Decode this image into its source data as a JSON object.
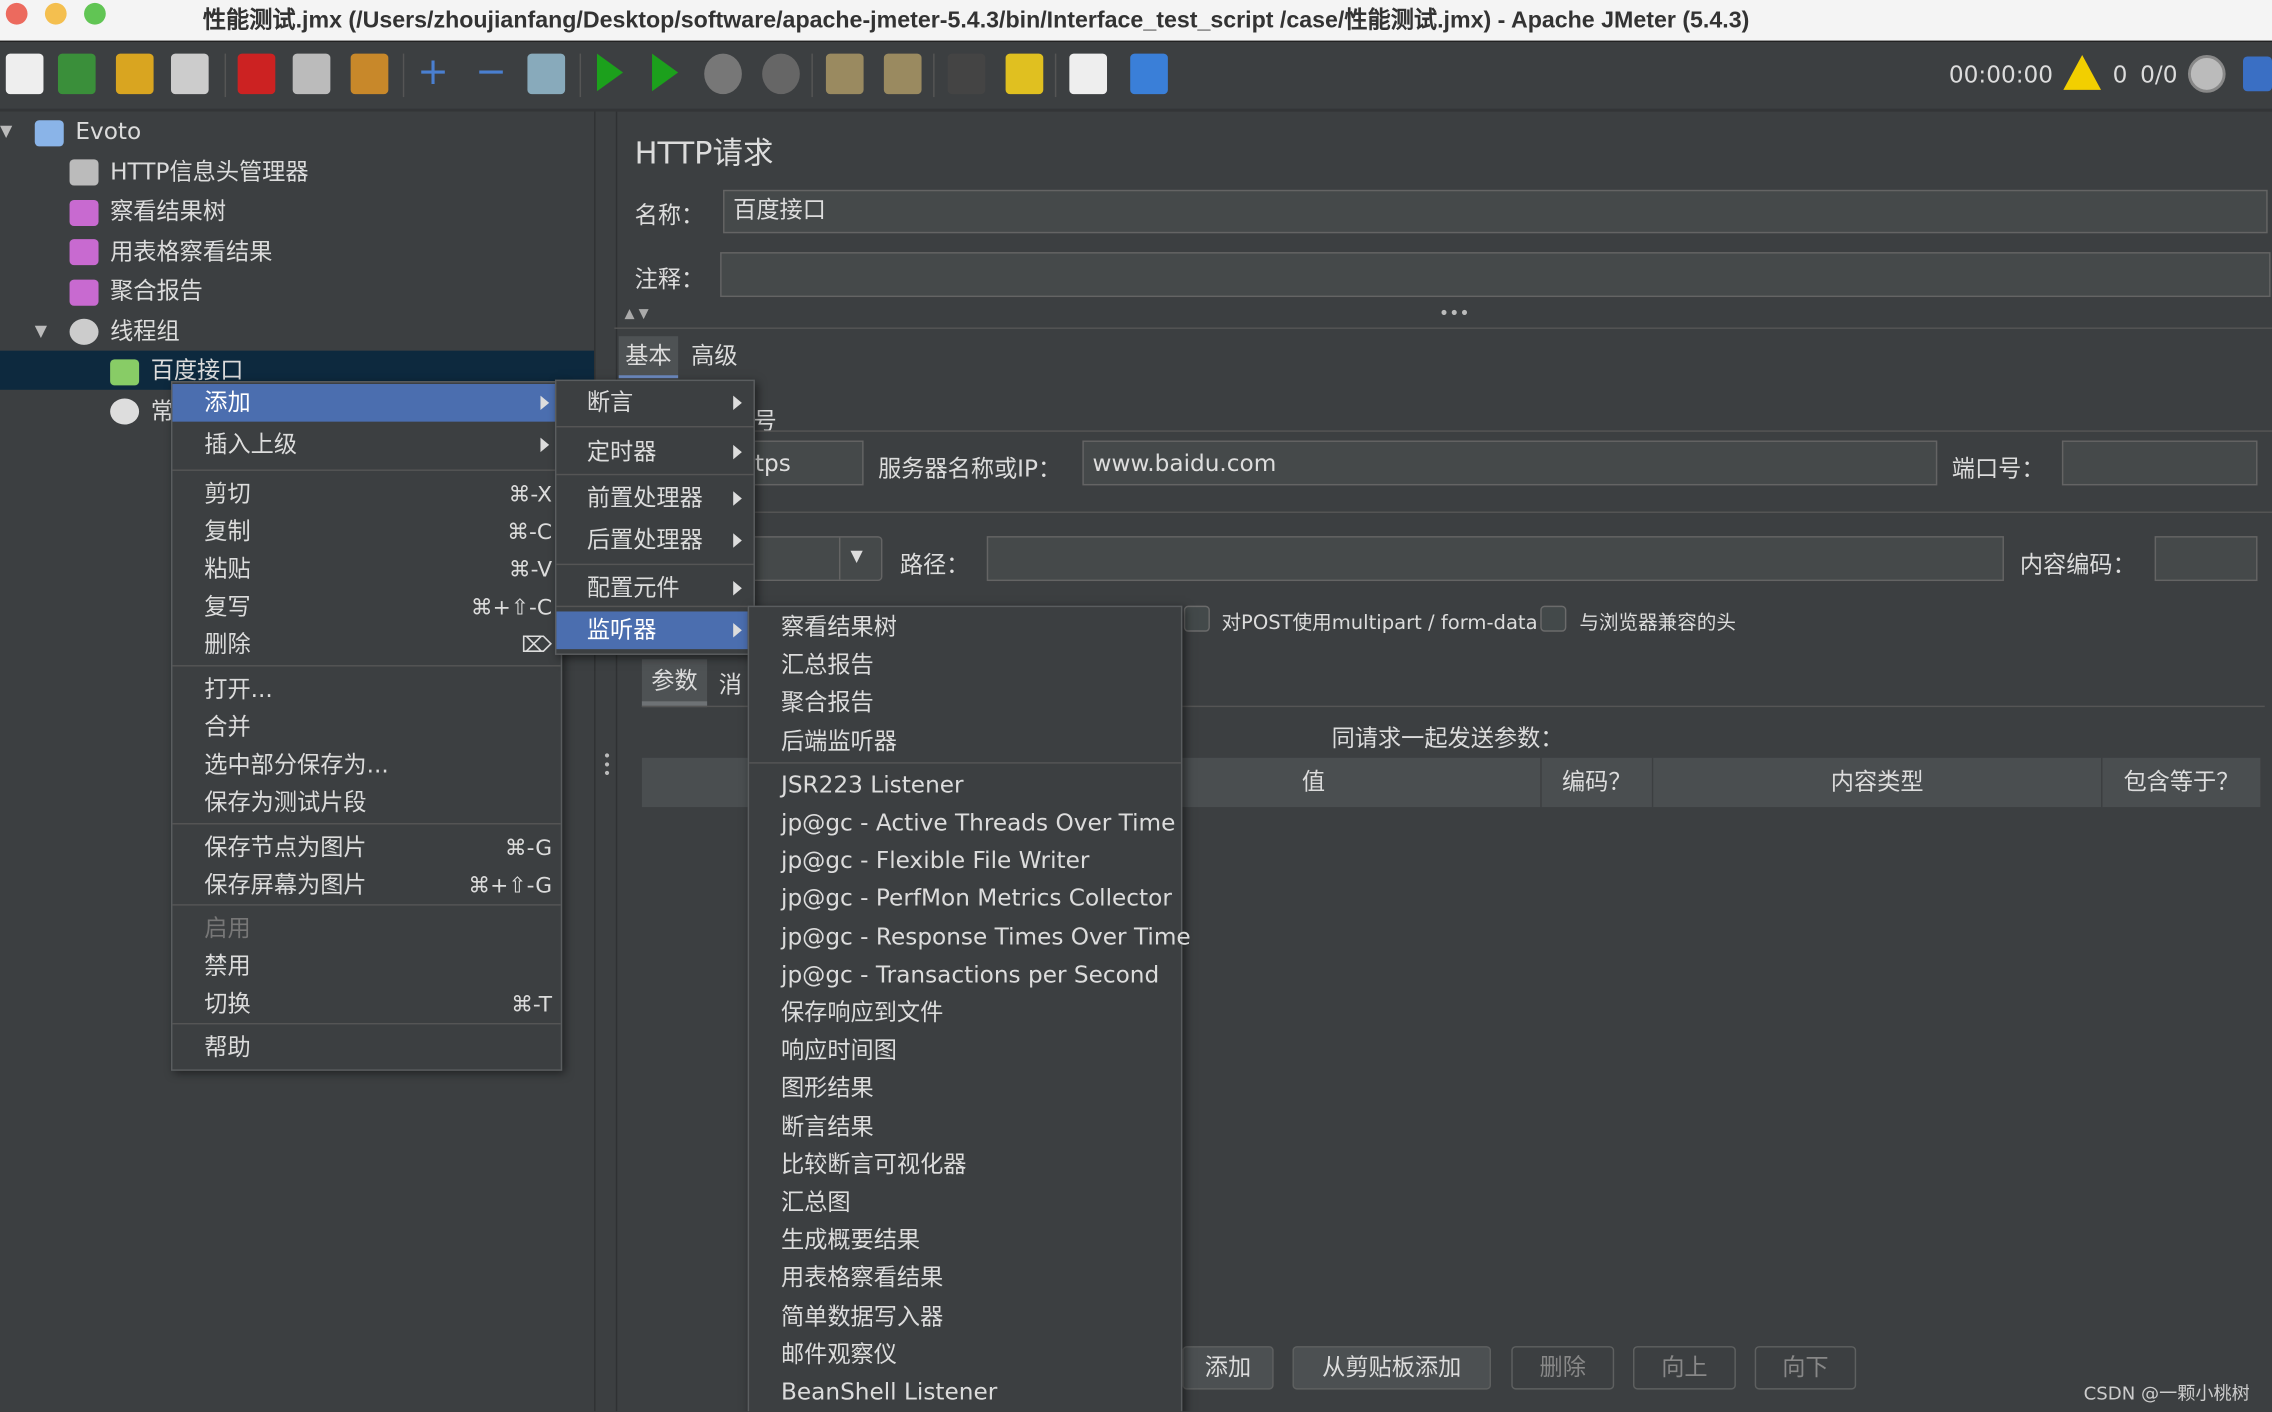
{
  "window": {
    "title": "性能测试.jmx (/Users/zhoujianfang/Desktop/software/apache-jmeter-5.4.3/bin/Interface_test_script  /case/性能测试.jmx) - Apache JMeter (5.4.3)"
  },
  "toolbar": {
    "timer": "00:00:00",
    "warnings": "0",
    "threads": "0/0",
    "icons": [
      "new-icon",
      "templates-icon",
      "open-icon",
      "save-icon",
      "cut-icon",
      "copy-icon",
      "paste-icon",
      "expand-icon",
      "collapse-icon",
      "toggle-icon",
      "start-icon",
      "start-no-pause-icon",
      "stop-icon",
      "shutdown-icon",
      "clear-icon",
      "clear-all-icon",
      "search-icon",
      "reset-search-icon",
      "function-helper-icon",
      "help-icon"
    ]
  },
  "tree": {
    "items": [
      {
        "label": "Evoto",
        "icon": "test-plan-icon"
      },
      {
        "label": "HTTP信息头管理器",
        "icon": "tools-icon"
      },
      {
        "label": "察看结果树",
        "icon": "listener-icon"
      },
      {
        "label": "用表格察看结果",
        "icon": "listener-icon"
      },
      {
        "label": "聚合报告",
        "icon": "listener-icon"
      },
      {
        "label": "线程组",
        "icon": "gear-icon"
      },
      {
        "label": "百度接口",
        "icon": "sampler-icon"
      },
      {
        "label": "常",
        "icon": "timer-icon"
      }
    ]
  },
  "panel": {
    "title": "HTTP请求",
    "name_label": "名称：",
    "name_value": "百度接口",
    "comment_label": "注释：",
    "comment_value": "",
    "tabs": [
      "基本",
      "高级"
    ],
    "web_server_partial": "号",
    "protocol_partial": "tps",
    "server_label": "服务器名称或IP：",
    "server_value": "www.baidu.com",
    "port_label": "端口号：",
    "port_value": "",
    "path_label": "路径：",
    "path_value": "",
    "encoding_label": "内容编码：",
    "encoding_value": "",
    "multipart_label": "对POST使用multipart / form-data",
    "browser_headers_label": "与浏览器兼容的头",
    "param_tabs": [
      "参数",
      "消"
    ],
    "params_caption": "同请求一起发送参数：",
    "columns": [
      "值",
      "编码？",
      "内容类型",
      "包含等于？"
    ],
    "buttons": [
      {
        "label": "添加",
        "enabled": true
      },
      {
        "label": "从剪贴板添加",
        "enabled": true
      },
      {
        "label": "删除",
        "enabled": false
      },
      {
        "label": "向上",
        "enabled": false
      },
      {
        "label": "向下",
        "enabled": false
      }
    ]
  },
  "context_menu": {
    "items": [
      {
        "label": "添加",
        "submenu": true,
        "selected": true
      },
      {
        "label": "插入上级",
        "submenu": true
      },
      {
        "label": "剪切",
        "shortcut": "⌘-X"
      },
      {
        "label": "复制",
        "shortcut": "⌘-C"
      },
      {
        "label": "粘贴",
        "shortcut": "⌘-V"
      },
      {
        "label": "复写",
        "shortcut": "⌘+⇧-C"
      },
      {
        "label": "删除",
        "shortcut": "⌦"
      },
      {
        "label": "打开..."
      },
      {
        "label": "合并"
      },
      {
        "label": "选中部分保存为..."
      },
      {
        "label": "保存为测试片段"
      },
      {
        "label": "保存节点为图片",
        "shortcut": "⌘-G"
      },
      {
        "label": "保存屏幕为图片",
        "shortcut": "⌘+⇧-G"
      },
      {
        "label": "启用",
        "disabled": true
      },
      {
        "label": "禁用"
      },
      {
        "label": "切换",
        "shortcut": "⌘-T"
      },
      {
        "label": "帮助"
      }
    ]
  },
  "add_submenu": {
    "items": [
      "断言",
      "定时器",
      "前置处理器",
      "后置处理器",
      "配置元件",
      "监听器"
    ],
    "selected": "监听器"
  },
  "listener_submenu": {
    "items": [
      "察看结果树",
      "汇总报告",
      "聚合报告",
      "后端监听器",
      "JSR223 Listener",
      "jp@gc - Active Threads Over Time",
      "jp@gc - Flexible File Writer",
      "jp@gc - PerfMon Metrics Collector",
      "jp@gc - Response Times Over Time",
      "jp@gc - Transactions per Second",
      "保存响应到文件",
      "响应时间图",
      "图形结果",
      "断言结果",
      "比较断言可视化器",
      "汇总图",
      "生成概要结果",
      "用表格察看结果",
      "简单数据写入器",
      "邮件观察仪",
      "BeanShell Listener"
    ]
  },
  "watermark": "CSDN @一颗小桃树",
  "colors": {
    "background": "#3c3f41",
    "selection": "#4b6eaf",
    "tree_selection": "#0d293e",
    "titlebar": "#f4f4f4"
  }
}
